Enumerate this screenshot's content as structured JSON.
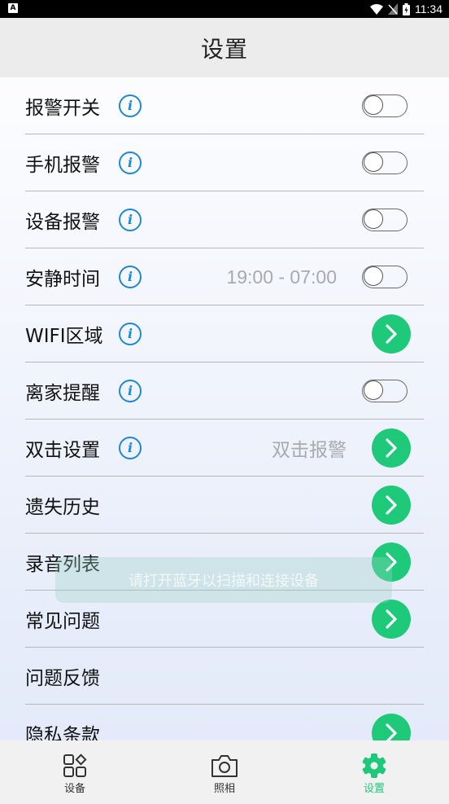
{
  "status_bar": {
    "time": "11:34",
    "left_icon_text": "A"
  },
  "header": {
    "title": "设置"
  },
  "info_glyph": "i",
  "rows": [
    {
      "label": "报警开关",
      "info": true,
      "value": "",
      "control": "toggle",
      "on": false
    },
    {
      "label": "手机报警",
      "info": true,
      "value": "",
      "control": "toggle",
      "on": false
    },
    {
      "label": "设备报警",
      "info": true,
      "value": "",
      "control": "toggle",
      "on": false
    },
    {
      "label": "安静时间",
      "info": true,
      "value": "19:00 - 07:00",
      "control": "toggle",
      "on": false
    },
    {
      "label": "WIFI区域",
      "info": true,
      "value": "",
      "control": "arrow"
    },
    {
      "label": "离家提醒",
      "info": true,
      "value": "",
      "control": "toggle",
      "on": false
    },
    {
      "label": "双击设置",
      "info": true,
      "value": "双击报警",
      "control": "arrow"
    },
    {
      "label": "遗失历史",
      "info": false,
      "value": "",
      "control": "arrow"
    },
    {
      "label": "录音列表",
      "info": false,
      "value": "",
      "control": "arrow"
    },
    {
      "label": "常见问题",
      "info": false,
      "value": "",
      "control": "arrow"
    },
    {
      "label": "问题反馈",
      "info": false,
      "value": "",
      "control": "none"
    },
    {
      "label": "隐私条款",
      "info": false,
      "value": "",
      "control": "arrow"
    }
  ],
  "toast": {
    "text": "请打开蓝牙以扫描和连接设备"
  },
  "tabs": [
    {
      "label": "设备",
      "icon": "devices-icon",
      "active": false
    },
    {
      "label": "照相",
      "icon": "camera-icon",
      "active": false
    },
    {
      "label": "设置",
      "icon": "settings-gear-icon",
      "active": true
    }
  ],
  "colors": {
    "accent": "#1fc97a",
    "info_blue": "#1e88d6",
    "header_bg": "#ececec"
  }
}
